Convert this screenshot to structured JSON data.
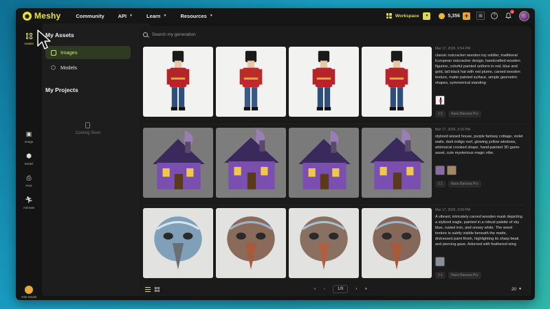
{
  "app": {
    "brand": "Meshy"
  },
  "nav": [
    {
      "label": "Community",
      "dropdown": false
    },
    {
      "label": "API",
      "dropdown": true
    },
    {
      "label": "Learn",
      "dropdown": true
    },
    {
      "label": "Resources",
      "dropdown": true
    }
  ],
  "topbar": {
    "workspace_label": "Workspace",
    "credits": "5,356",
    "notifications_count": "1"
  },
  "rail": {
    "assets": "Assets",
    "image": "Image",
    "model": "Model",
    "print": "Print",
    "animate": "Animate",
    "vote": "Vote Model"
  },
  "assets_panel": {
    "title": "My Assets",
    "items": [
      {
        "label": "Images",
        "active": true
      },
      {
        "label": "Models",
        "active": false
      }
    ],
    "projects_title": "My Projects",
    "coming_soon": "Coming Soon"
  },
  "search": {
    "placeholder": "Search my generation"
  },
  "generations": [
    {
      "date": "Mar 17, 2026, 6:54 PM",
      "prompt": "classic nutcracker wooden toy soldier, traditional European nutcracker design, handcrafted wooden figurine, colorful painted uniform in red, blue and gold, tall black hat with red plume, carved wooden texture, matte painted surface, simple geometric shapes, symmetrical standing",
      "ratio": "1:1",
      "model": "Nano Banana Pro"
    },
    {
      "date": "Mar 17, 2026, 3:16 PM",
      "prompt": "stylized wizard house, purple fantasy cottage, violet walls, dark indigo roof, glowing yellow windows, whimsical crooked shape, hand-painted 3D game asset, cute mysterious magic vibe.",
      "ratio": "1:1",
      "model": "Nano Banana Pro"
    },
    {
      "date": "Mar 17, 2026, 3:09 PM",
      "prompt": "A vibrant, intricately carved wooden mask depicting a stylized eagle, painted in a robust palette of sky blue, rusted iron, and snowy white. The wood texture is subtly visible beneath the matte, distressed paint finish, highlighting its sharp beak and piercing gaze. Adorned with feathered wing",
      "ratio": "1:1",
      "model": "Nano Banana Pro"
    }
  ],
  "pagination": {
    "current": "1/9",
    "per_page": "20"
  },
  "colors": {
    "accent": "#e2e24a",
    "background": "#141414",
    "panel": "#1d1d1d"
  }
}
